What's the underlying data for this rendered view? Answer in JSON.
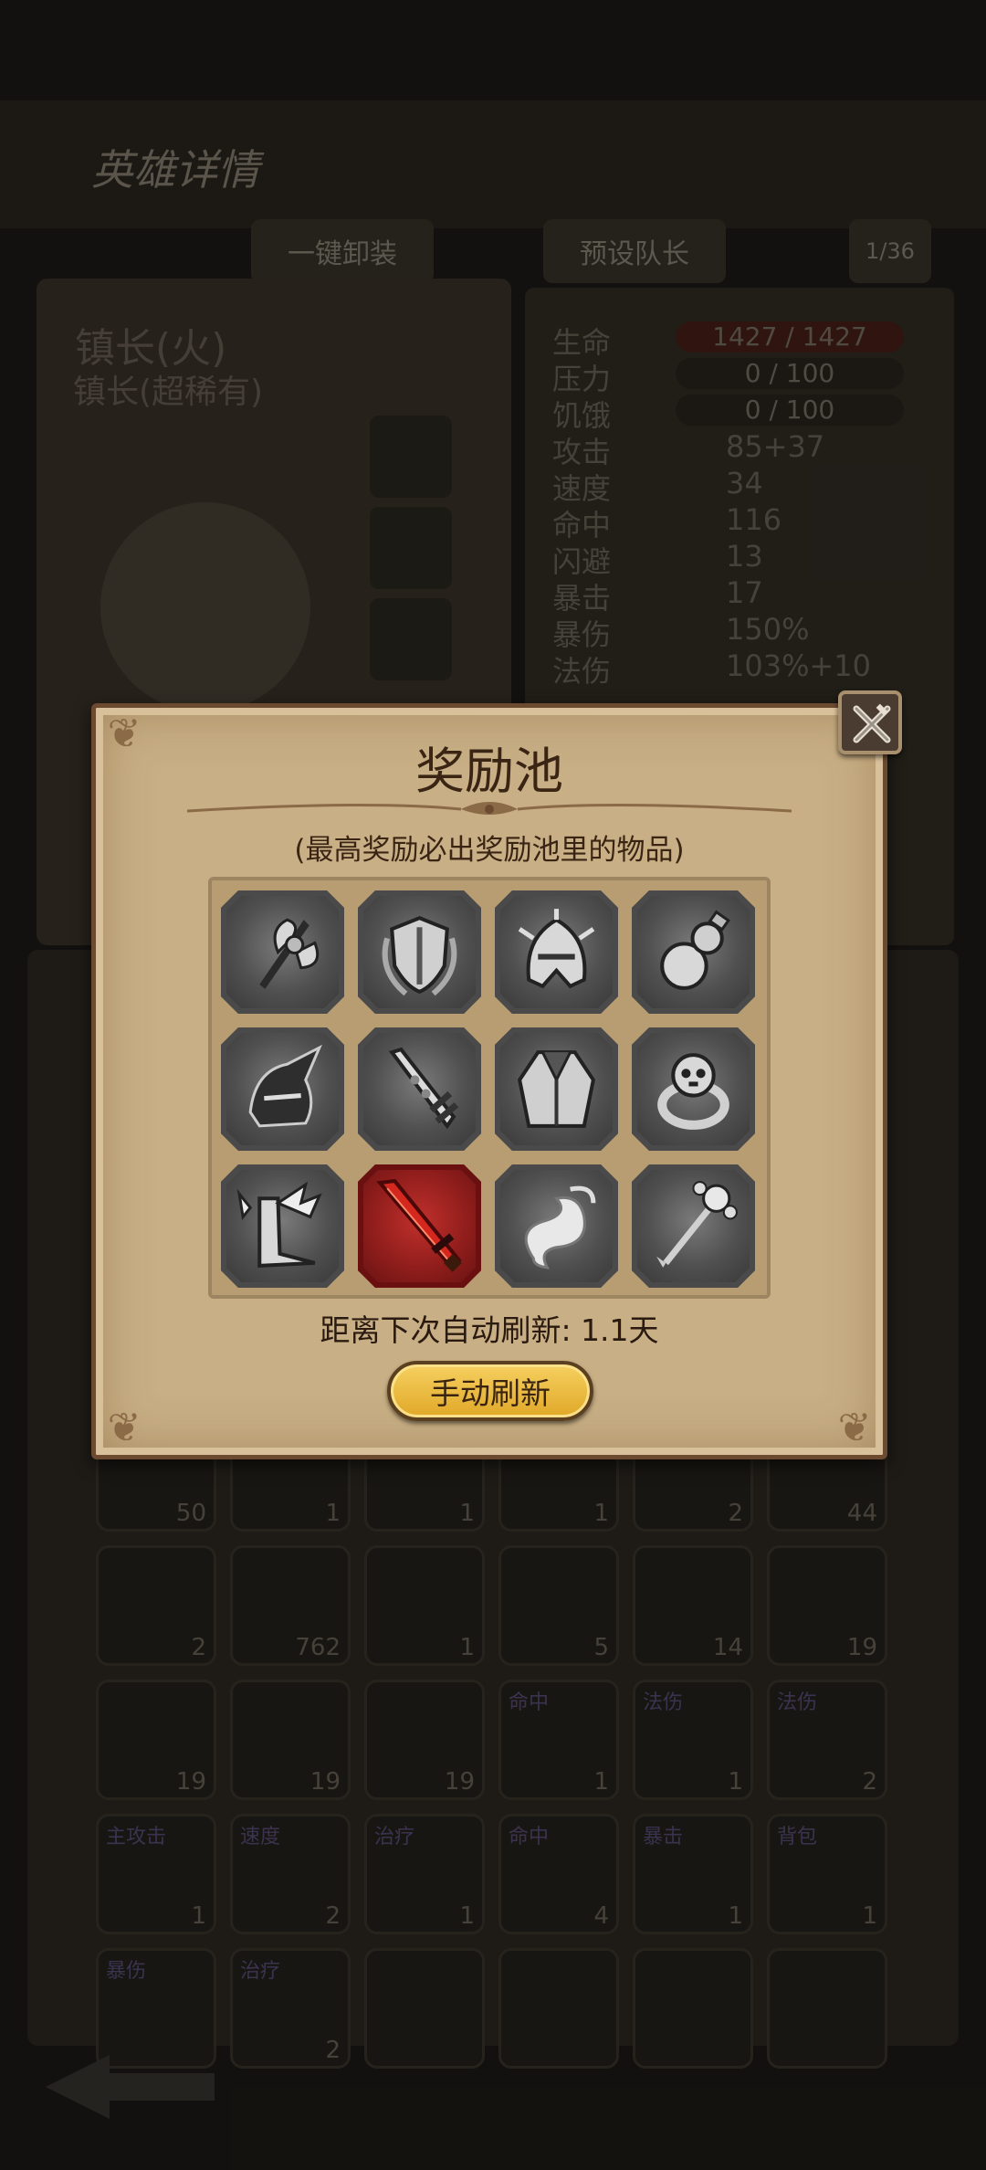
{
  "background": {
    "title": "英雄详情",
    "tabs": [
      "一键卸装",
      "预设队长",
      "1/36"
    ],
    "hero_name": "镇长(火)",
    "hero_subname": "镇长(超稀有)",
    "stats": [
      {
        "label": "生命",
        "value": "1427 / 1427",
        "bar": true
      },
      {
        "label": "压力",
        "value": "0 / 100",
        "bar": true
      },
      {
        "label": "饥饿",
        "value": "0 / 100",
        "bar": true
      },
      {
        "label": "攻击",
        "value": "85+37"
      },
      {
        "label": "速度",
        "value": "34"
      },
      {
        "label": "命中",
        "value": "116"
      },
      {
        "label": "闪避",
        "value": "13"
      },
      {
        "label": "暴击",
        "value": "17"
      },
      {
        "label": "暴伤",
        "value": "150%"
      },
      {
        "label": "法伤",
        "value": "103%+10"
      }
    ],
    "inventory_counts": [
      "50",
      "1",
      "1",
      "1",
      "2",
      "44",
      "2",
      "762",
      "1",
      "5",
      "14",
      "19",
      "19",
      "19",
      "19",
      "1",
      "1",
      "2",
      "1",
      "2",
      "1",
      "4",
      "1",
      "1",
      "",
      "2",
      "",
      "",
      "",
      ""
    ],
    "inventory_tags": [
      "",
      "",
      "",
      "",
      "",
      "",
      "",
      "",
      "",
      "",
      "",
      "",
      "",
      "",
      "",
      "命中",
      "法伤",
      "法伤",
      "主攻击",
      "速度",
      "治疗",
      "命中",
      "暴击",
      "背包",
      "暴伤",
      "治疗",
      "",
      "",
      "",
      ""
    ]
  },
  "modal": {
    "title": "奖励池",
    "subtitle": "(最高奖励必出奖励池里的物品)",
    "refresh_text": "距离下次自动刷新: 1.1天",
    "refresh_button": "手动刷新",
    "close_icon": "close-crossed-swords-icon",
    "items": [
      {
        "name": "battle-axe-icon",
        "rarity": "normal"
      },
      {
        "name": "laurel-shield-icon",
        "rarity": "normal"
      },
      {
        "name": "spiked-helmet-icon",
        "rarity": "normal"
      },
      {
        "name": "gourd-bottle-icon",
        "rarity": "normal"
      },
      {
        "name": "horned-helm-icon",
        "rarity": "normal"
      },
      {
        "name": "jeweled-sword-icon",
        "rarity": "normal"
      },
      {
        "name": "cloak-armor-icon",
        "rarity": "normal"
      },
      {
        "name": "skull-ring-icon",
        "rarity": "normal"
      },
      {
        "name": "winged-boots-icon",
        "rarity": "normal"
      },
      {
        "name": "crimson-blade-icon",
        "rarity": "red"
      },
      {
        "name": "spirit-wisp-icon",
        "rarity": "normal"
      },
      {
        "name": "flower-staff-icon",
        "rarity": "normal"
      }
    ],
    "colors": {
      "parchment": "#c8af85",
      "frame": "#6b4a30",
      "red_slot": "#8e1d1b",
      "button": "#e0a828"
    }
  }
}
